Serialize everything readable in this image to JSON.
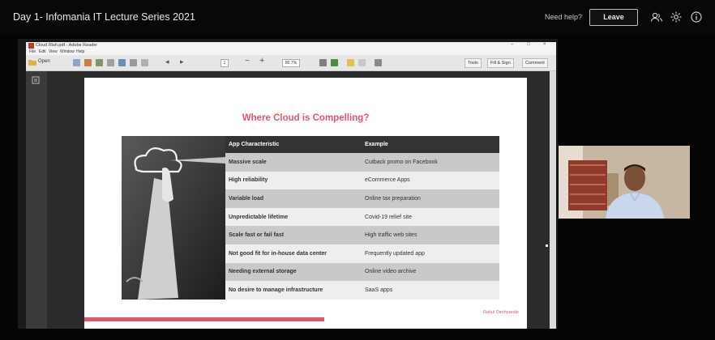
{
  "meeting": {
    "title": "Day 1- Infomania IT Lecture Series 2021",
    "need_help": "Need help?",
    "leave_label": "Leave",
    "icons": [
      "participants-icon",
      "settings-icon",
      "info-icon"
    ]
  },
  "reader": {
    "window_title": "Cloud Rish.pdf - Adobe Reader",
    "menu": [
      "File",
      "Edit",
      "View",
      "Window",
      "Help"
    ],
    "open_label": "Open",
    "page_number": "1",
    "zoom": "80.7%",
    "right_buttons": [
      "Tools",
      "Fill & Sign",
      "Comment"
    ]
  },
  "slide": {
    "title": "Where Cloud is Compelling?",
    "columns": [
      "App Characteristic",
      "Example"
    ],
    "rows": [
      [
        "Massive scale",
        "Cutback promo on Facebook"
      ],
      [
        "High reliability",
        "eCommerce Apps"
      ],
      [
        "Variable load",
        "Online tax preparation"
      ],
      [
        "Unpredictable lifetime",
        "Covid-19 relief site"
      ],
      [
        "Scale fast or fail fast",
        "High traffic web sites"
      ],
      [
        "Not good fit for in-house data center",
        "Frequently updated app"
      ],
      [
        "Needing external storage",
        "Online video archive"
      ],
      [
        "No desire to manage infrastructure",
        "SaaS apps"
      ]
    ],
    "author": "Rahul Deshpande"
  },
  "video": {
    "participant": "speaker-video"
  },
  "colors": {
    "accent": "#e35469",
    "table_header": "#333333",
    "background": "#050505"
  }
}
